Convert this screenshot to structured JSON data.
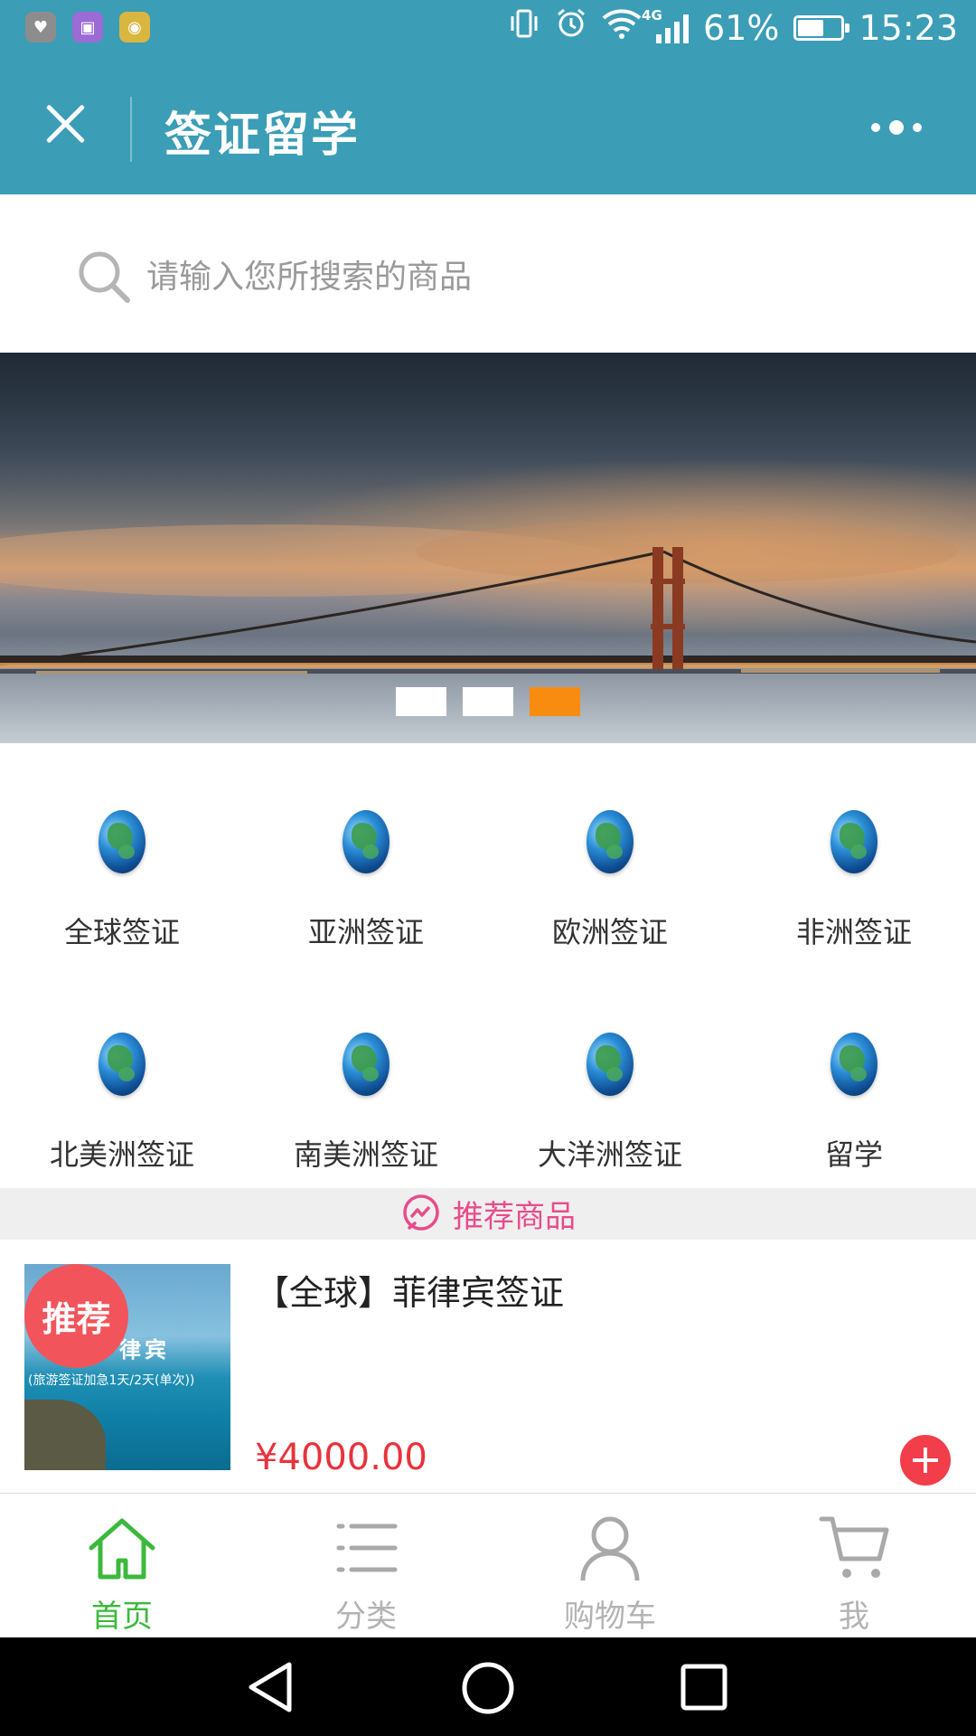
{
  "status_bar": {
    "app_icons": [
      "heart-app-icon",
      "gallery-app-icon",
      "camera-app-icon"
    ],
    "network": "4G",
    "battery": "61%",
    "battery_level": 0.61,
    "time": "15:23"
  },
  "titlebar": {
    "title": "签证留学"
  },
  "search": {
    "placeholder": "请输入您所搜索的商品"
  },
  "banner": {
    "slide_count": 3,
    "active_slide": 3
  },
  "categories": [
    {
      "label": "全球签证"
    },
    {
      "label": "亚洲签证"
    },
    {
      "label": "欧洲签证"
    },
    {
      "label": "非洲签证"
    },
    {
      "label": "北美洲签证"
    },
    {
      "label": "南美洲签证"
    },
    {
      "label": "大洋洲签证"
    },
    {
      "label": "留学"
    }
  ],
  "recommended": {
    "header": "推荐商品",
    "products": [
      {
        "badge": "推荐",
        "image_title": "律宾",
        "image_subtitle": "(旅游签证加急1天/2天(单次))",
        "name": "【全球】菲律宾签证",
        "price": "¥4000.00"
      }
    ]
  },
  "bottom_nav": [
    {
      "label": "首页",
      "icon": "home-icon",
      "active": true
    },
    {
      "label": "分类",
      "icon": "list-icon",
      "active": false
    },
    {
      "label": "购物车",
      "icon": "user-icon",
      "active": false
    },
    {
      "label": "我",
      "icon": "cart-icon",
      "active": false
    }
  ],
  "colors": {
    "header": "#3b9db6",
    "accent_green": "#3cb93c",
    "price_red": "#e8333d",
    "recommend_pink": "#e74c8b",
    "slider_active": "#f88c11"
  }
}
